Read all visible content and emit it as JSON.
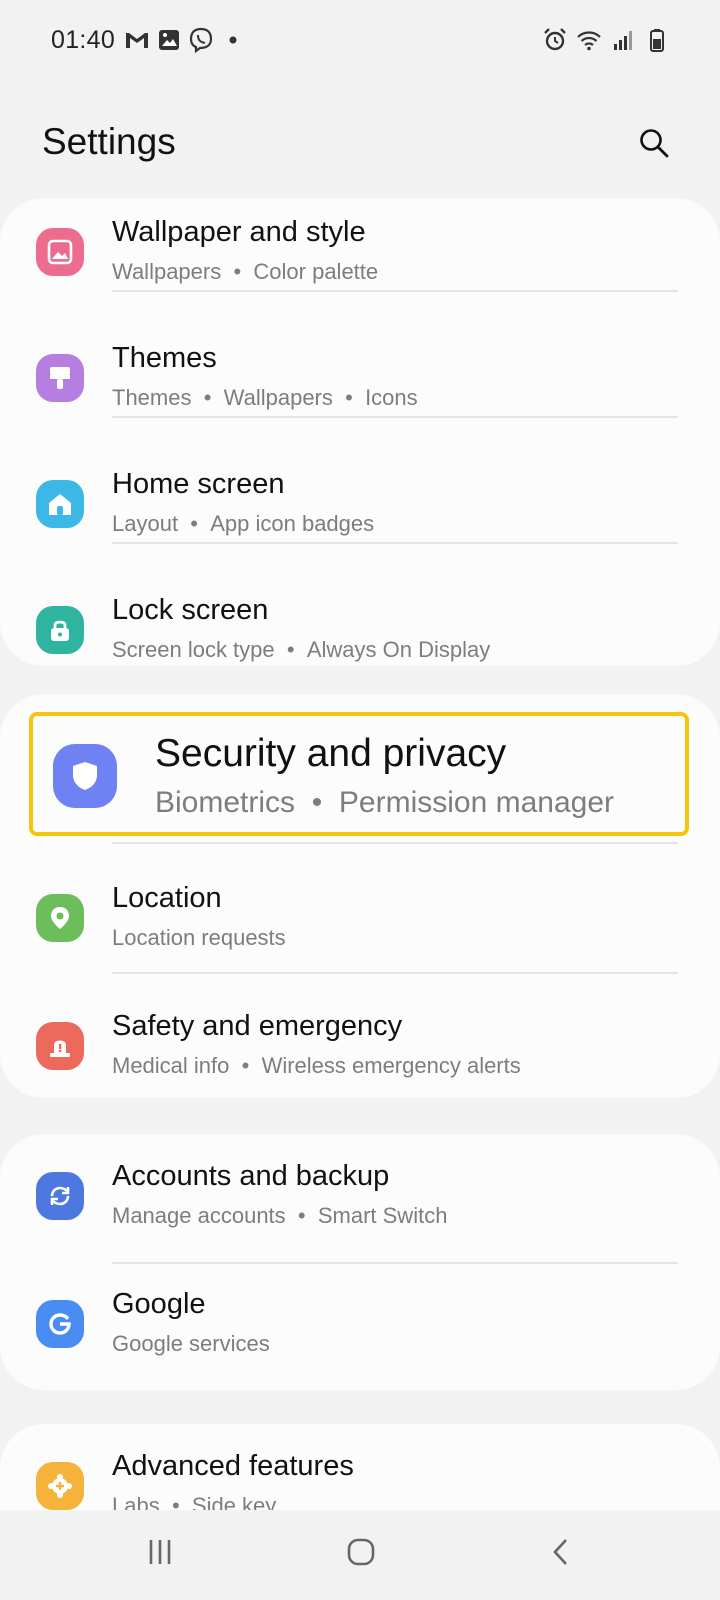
{
  "status": {
    "time": "01:40"
  },
  "header": {
    "title": "Settings"
  },
  "icons": {
    "search": "search-icon",
    "wallpaper": "wallpaper-icon",
    "themes": "paintbrush-icon",
    "home": "home-icon",
    "lock": "lock-icon",
    "security": "shield-icon",
    "location": "location-pin-icon",
    "safety": "emergency-alert-icon",
    "accounts": "sync-icon",
    "google": "google-icon",
    "advanced": "gear-plus-icon"
  },
  "colors": {
    "wallpaper": "#ec6b8f",
    "themes": "#b57ee0",
    "home": "#3cb8e6",
    "lock": "#2fb49f",
    "security": "#6e82f4",
    "location": "#6cbd5c",
    "safety": "#ec6a5c",
    "accounts": "#4c78e0",
    "google": "#4a8df2",
    "advanced": "#f6b33c",
    "highlight": "#f6c40b"
  },
  "card1": {
    "items": [
      {
        "title": "Wallpaper and style",
        "sub_a": "Wallpapers",
        "sub_b": "Color palette"
      },
      {
        "title": "Themes",
        "sub_a": "Themes",
        "sub_b": "Wallpapers",
        "sub_c": "Icons"
      },
      {
        "title": "Home screen",
        "sub_a": "Layout",
        "sub_b": "App icon badges"
      },
      {
        "title": "Lock screen",
        "sub_a": "Screen lock type",
        "sub_b": "Always On Display"
      }
    ]
  },
  "card2": {
    "items": [
      {
        "title": "Security and privacy",
        "sub_a": "Biometrics",
        "sub_b": "Permission manager"
      },
      {
        "title": "Location",
        "sub_a": "Location requests"
      },
      {
        "title": "Safety and emergency",
        "sub_a": "Medical info",
        "sub_b": "Wireless emergency alerts"
      }
    ]
  },
  "card3": {
    "items": [
      {
        "title": "Accounts and backup",
        "sub_a": "Manage accounts",
        "sub_b": "Smart Switch"
      },
      {
        "title": "Google",
        "sub_a": "Google services"
      }
    ]
  },
  "card4": {
    "items": [
      {
        "title": "Advanced features",
        "sub_a": "Labs",
        "sub_b": "Side key"
      }
    ]
  },
  "separator": "•"
}
